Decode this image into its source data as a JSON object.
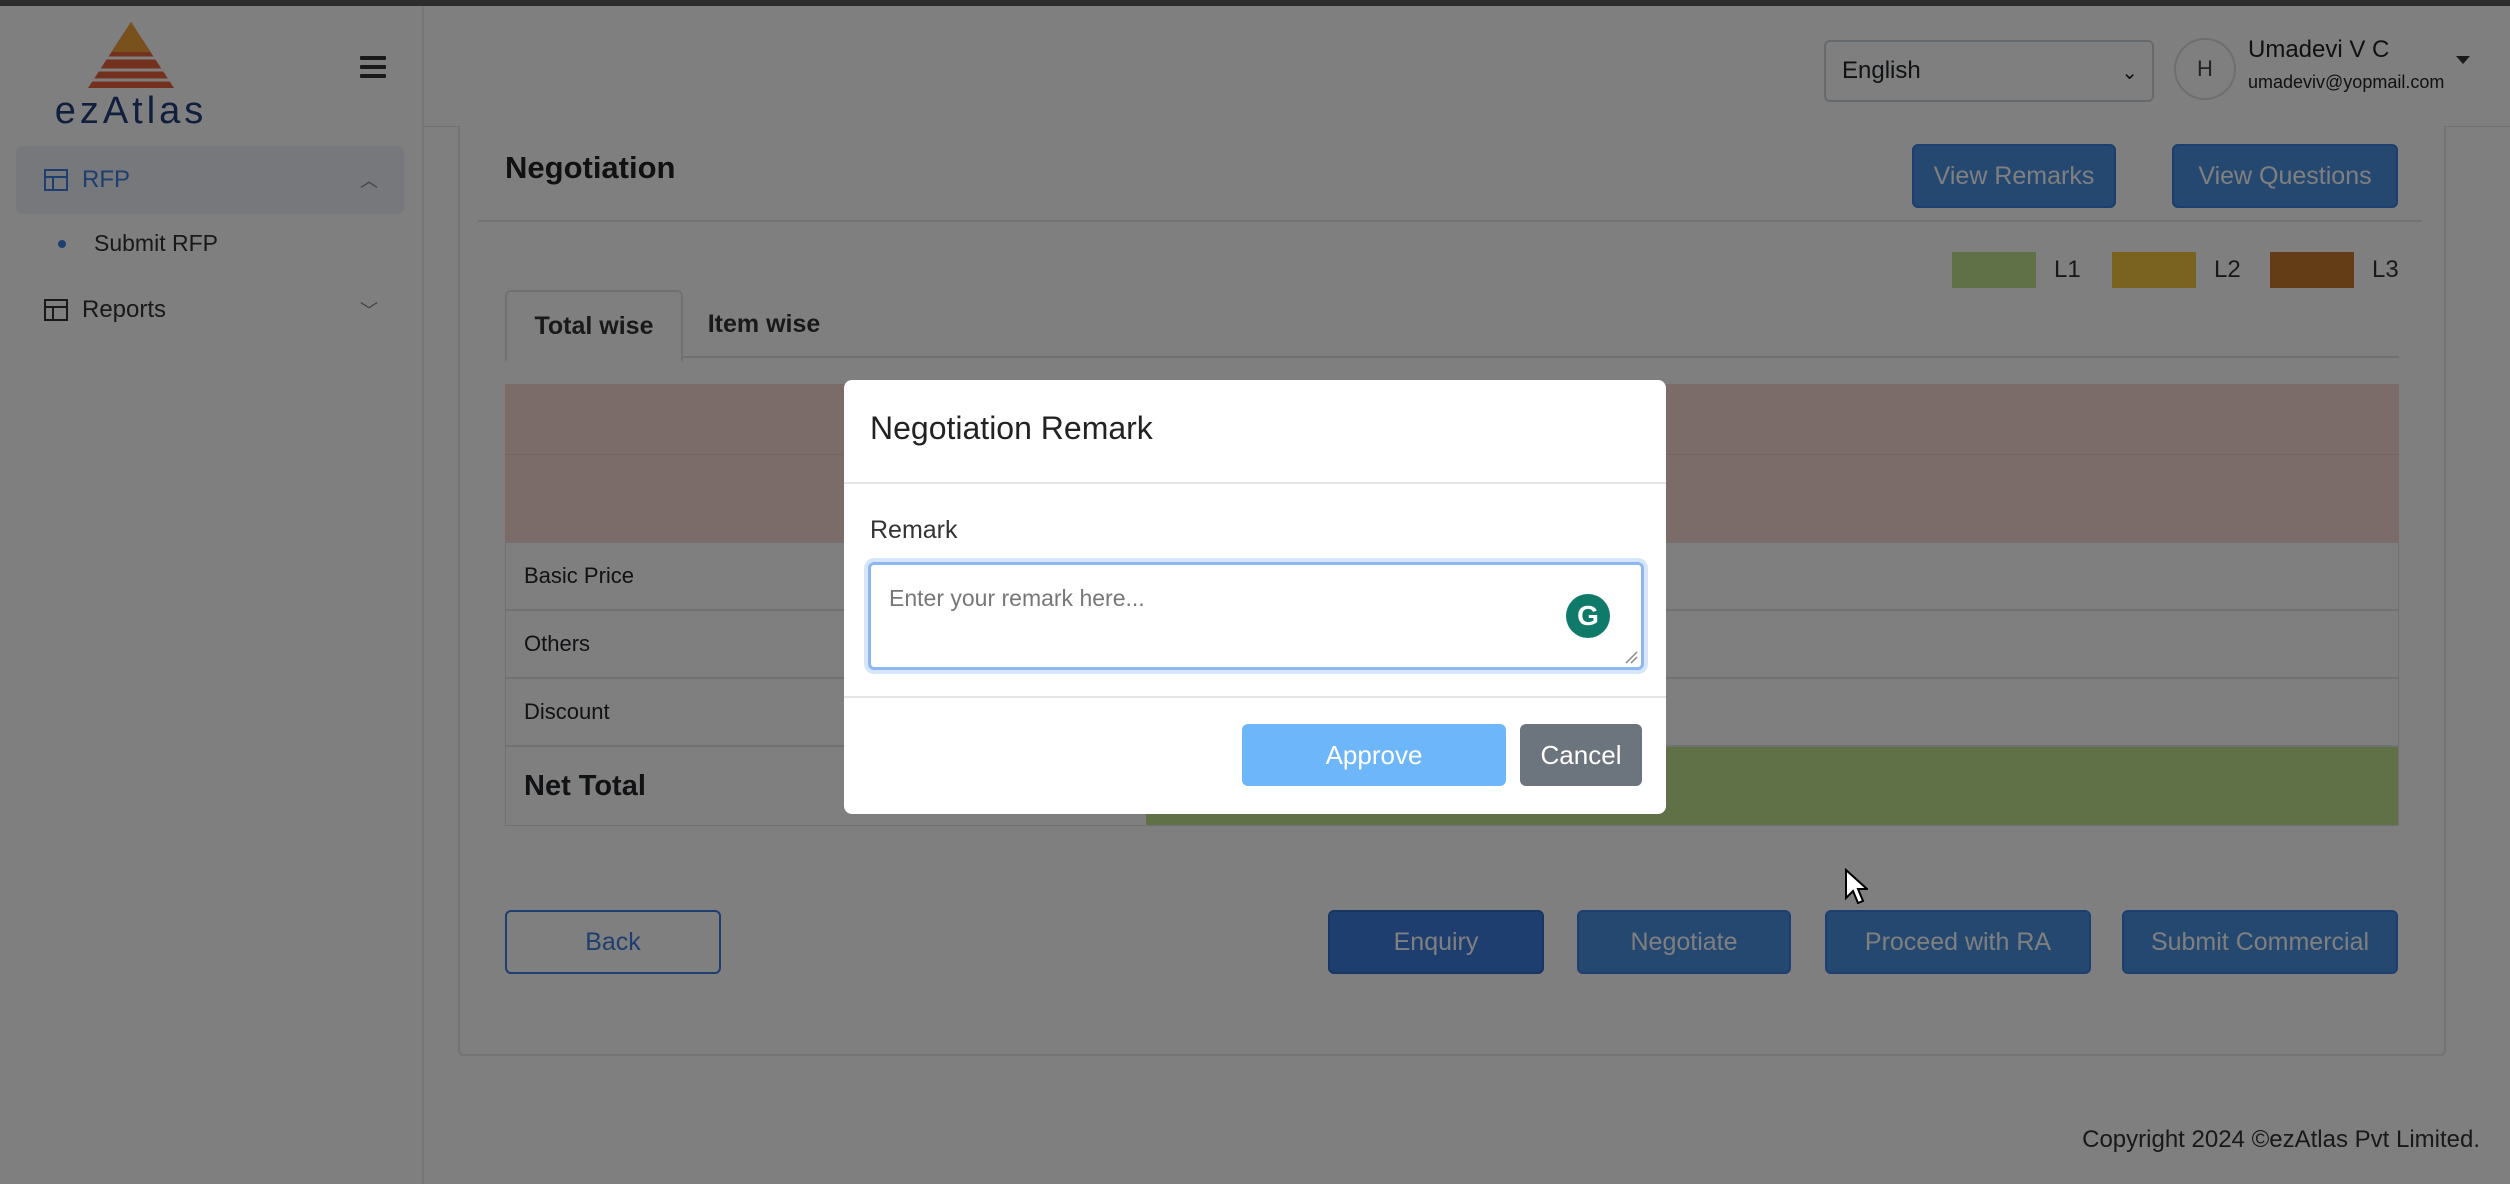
{
  "brand": {
    "logo_text": "ezAtlas"
  },
  "sidebar": {
    "items": [
      {
        "label": "RFP",
        "icon": "table-icon",
        "expanded": true
      },
      {
        "label": "Reports",
        "icon": "table-icon",
        "expanded": false
      }
    ],
    "sub_items": [
      {
        "label": "Submit RFP"
      }
    ]
  },
  "header": {
    "language": "English",
    "avatar_alt": "H",
    "user_name": "Umadevi V C",
    "user_email": "umadeviv@yopmail.com"
  },
  "page": {
    "title": "Negotiation",
    "view_remarks_label": "View Remarks",
    "view_questions_label": "View Questions",
    "legend": [
      {
        "label": "L1",
        "color": "#c1e28f"
      },
      {
        "label": "L2",
        "color": "#f5c542"
      },
      {
        "label": "L3",
        "color": "#c8792c"
      }
    ],
    "tabs": [
      {
        "label": "Total wise",
        "active": true
      },
      {
        "label": "Item wise",
        "active": false
      }
    ],
    "rows": [
      {
        "label": "Basic Price"
      },
      {
        "label": "Others"
      },
      {
        "label": "Discount"
      },
      {
        "label": "Net Total"
      }
    ],
    "buttons": {
      "back": "Back",
      "enquiry": "Enquiry",
      "negotiate": "Negotiate",
      "proceed_ra": "Proceed with RA",
      "submit_commercial": "Submit Commercial"
    }
  },
  "footer": {
    "copyright": "Copyright 2024 ©ezAtlas Pvt Limited."
  },
  "modal": {
    "title": "Negotiation Remark",
    "remark_label": "Remark",
    "remark_placeholder": "Enter your remark here...",
    "remark_value": "",
    "approve_label": "Approve",
    "cancel_label": "Cancel"
  }
}
